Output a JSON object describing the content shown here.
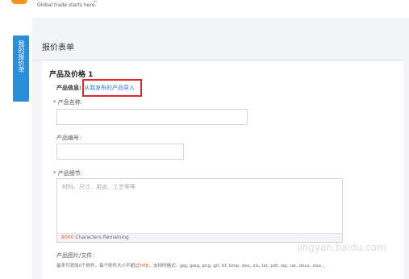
{
  "header": {
    "slogan": "Global trade starts here.",
    "slogan_mark": "™"
  },
  "sidebar_tab": {
    "label": "我的报价单",
    "arrow_icon": "chevron-right-icon",
    "color": "#2b8ed8"
  },
  "form": {
    "title": "报价表单",
    "section_title": "产品及价格 1",
    "product_info_label": "产品信息:",
    "import_link": "从我发布的产品导入",
    "name_label": "产品名称:",
    "name_value": "",
    "number_label": "产品编号:",
    "number_value": "",
    "detail_label": "产品细节:",
    "detail_placeholder": "材料、尺寸、用途、工艺等等",
    "char_count": "8000",
    "char_remaining_text": "Characters Remaining",
    "images_label": "产品图片/文件:",
    "rules_prefix": "最多可添加",
    "rules_max_files": "6",
    "rules_middle": "个附件，每个附件大小不超过",
    "rules_max_size": "5MB",
    "rules_suffix": "，支持的格式：jpg, jpeg, png, gif, tif, bmp, doc, xls, txt, pdf, zip, rar, docx, xlsx ；"
  },
  "colors": {
    "link": "#2b7bd6",
    "required": "#e0252b",
    "highlight": "#e0252b",
    "accent_orange": "#e86b2a"
  },
  "watermark": "jingyan.baidu.com"
}
